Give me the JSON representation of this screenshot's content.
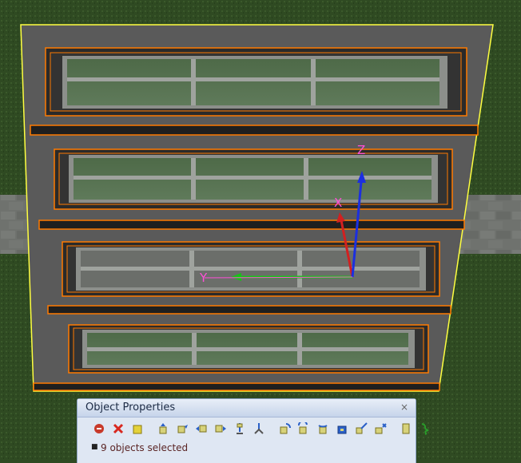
{
  "scene": {
    "axis_labels": {
      "x": "X",
      "y": "Y",
      "z": "Z"
    },
    "colors": {
      "grass": "#2f4a22",
      "pavement": "#6f726e",
      "wall": "#595959",
      "selection_outline": "#ffff40",
      "frame_outline": "#ff7a00",
      "axis_x": "#d22020",
      "axis_y": "#16c416",
      "axis_z": "#1c2fe0",
      "axis_label": "#ff4fd8"
    }
  },
  "object_properties": {
    "title": "Object Properties",
    "close_label": "×",
    "toolbar_icons": [
      "link-object-icon",
      "unlink-object-icon",
      "select-object-icon",
      "move-up-icon",
      "move-forward-icon",
      "move-left-icon",
      "move-right-icon",
      "snap-object-icon",
      "drop-object-icon",
      "rotate-x-icon",
      "rotate-y-icon",
      "rotate-z-icon",
      "rotate-reset-icon",
      "scale-object-icon",
      "align-object-icon",
      "copy-object-icon",
      "more-tools-icon"
    ],
    "status": "9 objects selected"
  }
}
